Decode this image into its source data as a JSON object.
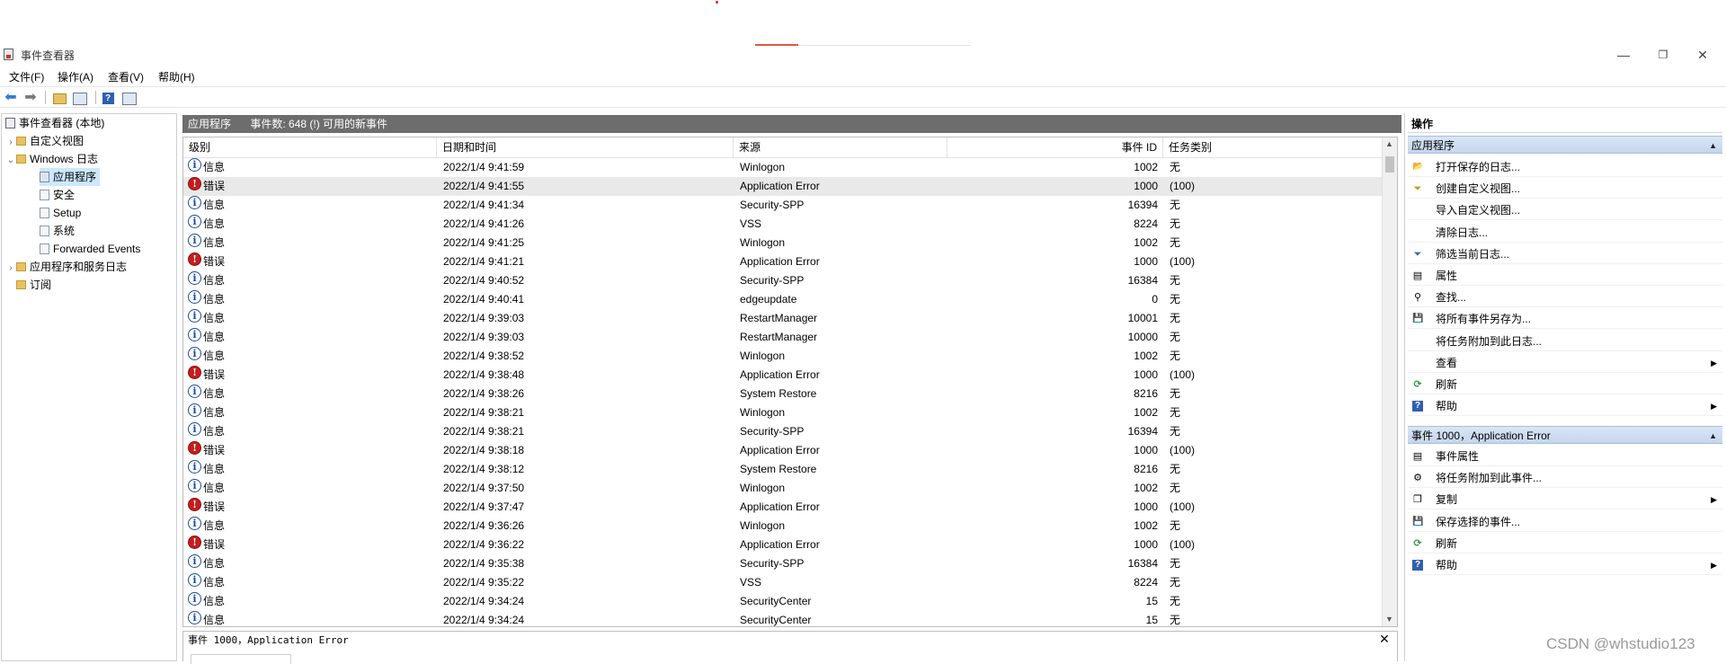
{
  "window": {
    "title": "事件查看器",
    "controls": {
      "minimize": "—",
      "restore": "❐",
      "close": "✕"
    }
  },
  "menu": [
    "文件(F)",
    "操作(A)",
    "查看(V)",
    "帮助(H)"
  ],
  "toolbar": {
    "icons": [
      "back-arrow-icon",
      "forward-arrow-icon",
      "open-folder-icon",
      "show-hide-tree-icon",
      "help-icon",
      "show-hide-actions-icon"
    ]
  },
  "tree": {
    "root": "事件查看器 (本地)",
    "custom_views": "自定义视图",
    "windows_logs": "Windows 日志",
    "logs": [
      "应用程序",
      "安全",
      "Setup",
      "系统",
      "Forwarded Events"
    ],
    "app_service_logs": "应用程序和服务日志",
    "subscriptions": "订阅"
  },
  "log_header": {
    "name": "应用程序",
    "count": "事件数: 648 (!) 可用的新事件"
  },
  "columns": [
    "级别",
    "日期和时间",
    "来源",
    "事件 ID",
    "任务类别"
  ],
  "events": [
    {
      "level": "信息",
      "type": "info",
      "time": "2022/1/4 9:41:59",
      "source": "Winlogon",
      "id": "1002",
      "task": "无"
    },
    {
      "level": "错误",
      "type": "error",
      "time": "2022/1/4 9:41:55",
      "source": "Application Error",
      "id": "1000",
      "task": "(100)"
    },
    {
      "level": "信息",
      "type": "info",
      "time": "2022/1/4 9:41:34",
      "source": "Security-SPP",
      "id": "16394",
      "task": "无"
    },
    {
      "level": "信息",
      "type": "info",
      "time": "2022/1/4 9:41:26",
      "source": "VSS",
      "id": "8224",
      "task": "无"
    },
    {
      "level": "信息",
      "type": "info",
      "time": "2022/1/4 9:41:25",
      "source": "Winlogon",
      "id": "1002",
      "task": "无"
    },
    {
      "level": "错误",
      "type": "error",
      "time": "2022/1/4 9:41:21",
      "source": "Application Error",
      "id": "1000",
      "task": "(100)"
    },
    {
      "level": "信息",
      "type": "info",
      "time": "2022/1/4 9:40:52",
      "source": "Security-SPP",
      "id": "16384",
      "task": "无"
    },
    {
      "level": "信息",
      "type": "info",
      "time": "2022/1/4 9:40:41",
      "source": "edgeupdate",
      "id": "0",
      "task": "无"
    },
    {
      "level": "信息",
      "type": "info",
      "time": "2022/1/4 9:39:03",
      "source": "RestartManager",
      "id": "10001",
      "task": "无"
    },
    {
      "level": "信息",
      "type": "info",
      "time": "2022/1/4 9:39:03",
      "source": "RestartManager",
      "id": "10000",
      "task": "无"
    },
    {
      "level": "信息",
      "type": "info",
      "time": "2022/1/4 9:38:52",
      "source": "Winlogon",
      "id": "1002",
      "task": "无"
    },
    {
      "level": "错误",
      "type": "error",
      "time": "2022/1/4 9:38:48",
      "source": "Application Error",
      "id": "1000",
      "task": "(100)"
    },
    {
      "level": "信息",
      "type": "info",
      "time": "2022/1/4 9:38:26",
      "source": "System Restore",
      "id": "8216",
      "task": "无"
    },
    {
      "level": "信息",
      "type": "info",
      "time": "2022/1/4 9:38:21",
      "source": "Winlogon",
      "id": "1002",
      "task": "无"
    },
    {
      "level": "信息",
      "type": "info",
      "time": "2022/1/4 9:38:21",
      "source": "Security-SPP",
      "id": "16394",
      "task": "无"
    },
    {
      "level": "错误",
      "type": "error",
      "time": "2022/1/4 9:38:18",
      "source": "Application Error",
      "id": "1000",
      "task": "(100)"
    },
    {
      "level": "信息",
      "type": "info",
      "time": "2022/1/4 9:38:12",
      "source": "System Restore",
      "id": "8216",
      "task": "无"
    },
    {
      "level": "信息",
      "type": "info",
      "time": "2022/1/4 9:37:50",
      "source": "Winlogon",
      "id": "1002",
      "task": "无"
    },
    {
      "level": "错误",
      "type": "error",
      "time": "2022/1/4 9:37:47",
      "source": "Application Error",
      "id": "1000",
      "task": "(100)"
    },
    {
      "level": "信息",
      "type": "info",
      "time": "2022/1/4 9:36:26",
      "source": "Winlogon",
      "id": "1002",
      "task": "无"
    },
    {
      "level": "错误",
      "type": "error",
      "time": "2022/1/4 9:36:22",
      "source": "Application Error",
      "id": "1000",
      "task": "(100)"
    },
    {
      "level": "信息",
      "type": "info",
      "time": "2022/1/4 9:35:38",
      "source": "Security-SPP",
      "id": "16384",
      "task": "无"
    },
    {
      "level": "信息",
      "type": "info",
      "time": "2022/1/4 9:35:22",
      "source": "VSS",
      "id": "8224",
      "task": "无"
    },
    {
      "level": "信息",
      "type": "info",
      "time": "2022/1/4 9:34:24",
      "source": "SecurityCenter",
      "id": "15",
      "task": "无"
    },
    {
      "level": "信息",
      "type": "info",
      "time": "2022/1/4 9:34:24",
      "source": "SecurityCenter",
      "id": "15",
      "task": "无"
    }
  ],
  "detail": {
    "title": "事件 1000，Application Error",
    "close": "✕"
  },
  "actions": {
    "header": "操作",
    "section1": {
      "title": "应用程序",
      "items": [
        {
          "label": "打开保存的日志...",
          "icon": "open-folder-icon"
        },
        {
          "label": "创建自定义视图...",
          "icon": "filter-create-icon"
        },
        {
          "label": "导入自定义视图...",
          "icon": ""
        },
        {
          "label": "清除日志...",
          "icon": ""
        },
        {
          "label": "筛选当前日志...",
          "icon": "filter-icon"
        },
        {
          "label": "属性",
          "icon": "properties-icon"
        },
        {
          "label": "查找...",
          "icon": "find-binoculars-icon"
        },
        {
          "label": "将所有事件另存为...",
          "icon": "save-icon"
        },
        {
          "label": "将任务附加到此日志...",
          "icon": ""
        },
        {
          "label": "查看",
          "icon": "",
          "submenu": true
        },
        {
          "label": "刷新",
          "icon": "refresh-icon"
        },
        {
          "label": "帮助",
          "icon": "help-icon",
          "submenu": true
        }
      ]
    },
    "section2": {
      "title": "事件 1000，Application Error",
      "items": [
        {
          "label": "事件属性",
          "icon": "properties-icon"
        },
        {
          "label": "将任务附加到此事件...",
          "icon": "task-icon"
        },
        {
          "label": "复制",
          "icon": "copy-icon",
          "submenu": true
        },
        {
          "label": "保存选择的事件...",
          "icon": "save-icon"
        },
        {
          "label": "刷新",
          "icon": "refresh-icon"
        },
        {
          "label": "帮助",
          "icon": "help-icon",
          "submenu": true
        }
      ]
    }
  },
  "watermark": "CSDN @whstudio123",
  "colors": {
    "error": "#c41d1d",
    "info": "#1b4d9a",
    "header_bar": "#6d6d6d",
    "selection": "#cce8ff",
    "section_header": "#c4d6ee"
  }
}
